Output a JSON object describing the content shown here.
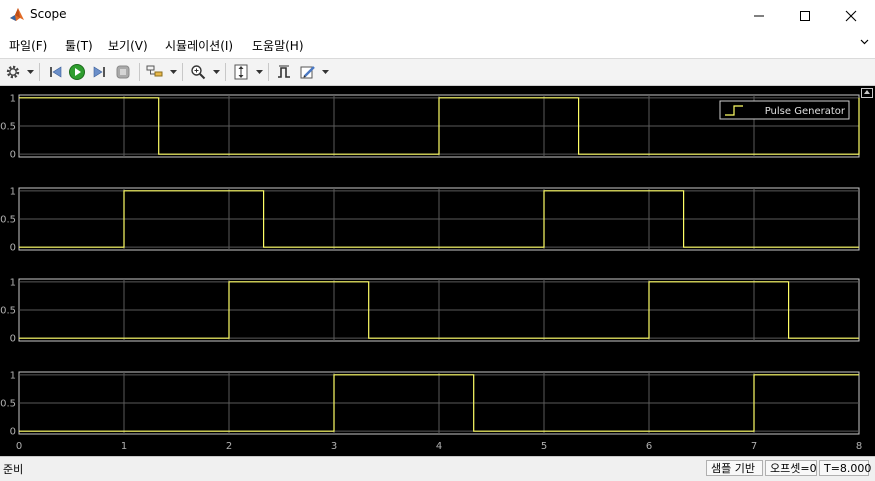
{
  "window": {
    "title": "Scope",
    "minimize_glyph": "—",
    "maximize_glyph": "☐",
    "close_glyph": "✕"
  },
  "menu": [
    {
      "label": "파일(F)",
      "name": "menu-file"
    },
    {
      "label": "툴(T)",
      "name": "menu-tools"
    },
    {
      "label": "보기(V)",
      "name": "menu-view"
    },
    {
      "label": "시뮬레이션(I)",
      "name": "menu-simulation"
    },
    {
      "label": "도움말(H)",
      "name": "menu-help"
    }
  ],
  "toolbar": {
    "icons": [
      "gear-icon",
      "step-back-icon",
      "run-icon",
      "step-forward-icon",
      "stop-icon",
      "signal-selector-icon",
      "zoom-icon",
      "scale-axes-icon",
      "cursor-measure-icon",
      "style-icon"
    ]
  },
  "colors": {
    "signal": "#ffff66",
    "grid": "#5a5a5a",
    "axes": "#c8c8c8",
    "background": "#000000",
    "run_green": "#2e9d2e"
  },
  "legend": {
    "label": "Pulse Generator"
  },
  "chart_data": {
    "type": "line",
    "x_range": [
      0,
      8
    ],
    "x_ticks": [
      "0",
      "1",
      "2",
      "3",
      "4",
      "5",
      "6",
      "7",
      "8"
    ],
    "y_ticks": [
      "0",
      "0.5",
      "1"
    ],
    "ylim": [
      -0.05,
      1.05
    ],
    "grid": true,
    "legend_position": "top-right",
    "subplots": [
      {
        "name": "Pulse Generator",
        "x": [
          0,
          1.33,
          1.33,
          4,
          4,
          5.33,
          5.33,
          8,
          8
        ],
        "y": [
          1,
          1,
          0,
          0,
          1,
          1,
          0,
          0,
          1
        ]
      },
      {
        "x": [
          0,
          1,
          1,
          2.33,
          2.33,
          5,
          5,
          6.33,
          6.33,
          8
        ],
        "y": [
          0,
          0,
          1,
          1,
          0,
          0,
          1,
          1,
          0,
          0
        ]
      },
      {
        "x": [
          0,
          2,
          2,
          3.33,
          3.33,
          6,
          6,
          7.33,
          7.33,
          8
        ],
        "y": [
          0,
          0,
          1,
          1,
          0,
          0,
          1,
          1,
          0,
          0
        ]
      },
      {
        "x": [
          0,
          3,
          3,
          4.33,
          4.33,
          7,
          7,
          8
        ],
        "y": [
          0,
          0,
          1,
          1,
          0,
          0,
          1,
          1
        ]
      }
    ]
  },
  "status": {
    "ready": "준비",
    "sample_based": "샘플 기반",
    "offset": "오프셋=0",
    "time": "T=8.000"
  }
}
